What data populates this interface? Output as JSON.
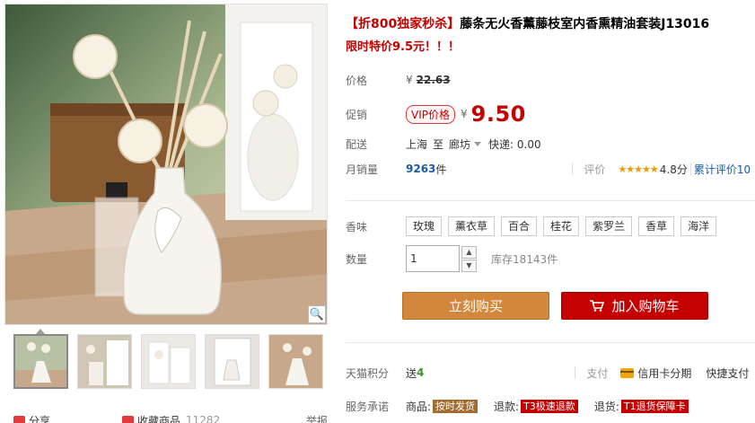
{
  "product": {
    "title_flash": "【折800独家秒杀】",
    "title_main": "藤条无火香薰藤枝室内香熏精油套装J13016",
    "subtitle": "限时特价9.5元！！！"
  },
  "price": {
    "label": "价格",
    "currency": "¥",
    "original": "22.63"
  },
  "promo": {
    "label": "促销",
    "badge": "VIP价格",
    "currency": "¥",
    "value": "9.50"
  },
  "delivery": {
    "label": "配送",
    "from": "上海",
    "to_word": "至",
    "to": "廊坊",
    "shipping": "快递: 0.00"
  },
  "sales": {
    "label": "月销量",
    "count": "9263",
    "unit": "件",
    "rating_label": "评价",
    "stars": "★★★★★",
    "score": "4.8分",
    "reviews": "累计评价10"
  },
  "scent": {
    "label": "香味",
    "options": [
      "玫瑰",
      "薰衣草",
      "百合",
      "桂花",
      "紫罗兰",
      "香草",
      "海洋"
    ]
  },
  "quantity": {
    "label": "数量",
    "value": "1",
    "up": "▲",
    "down": "▼",
    "stock": "库存18143件"
  },
  "buttons": {
    "buy_now": "立刻购买",
    "add_cart": "加入购物车"
  },
  "points": {
    "label": "天猫积分",
    "give": "送",
    "amount": "4",
    "pay_label": "支付",
    "credit": "信用卡分期",
    "fast_pay": "快捷支付"
  },
  "promise": {
    "label": "服务承诺",
    "items": [
      {
        "prefix": "商品:",
        "tag": "按时发货"
      },
      {
        "prefix": "退款:",
        "tag": "T3极速退款"
      },
      {
        "prefix": "退货:",
        "tag": "T1退货保障卡"
      }
    ]
  },
  "gallery": {
    "zoom_icon": "🔍",
    "share": "分享",
    "favorite": "收藏商品",
    "favorite_count": "11282",
    "report": "举报"
  },
  "colors": {
    "accent_red": "#c40000",
    "buy_orange": "#d2873c",
    "link_blue": "#1a5aa6"
  }
}
